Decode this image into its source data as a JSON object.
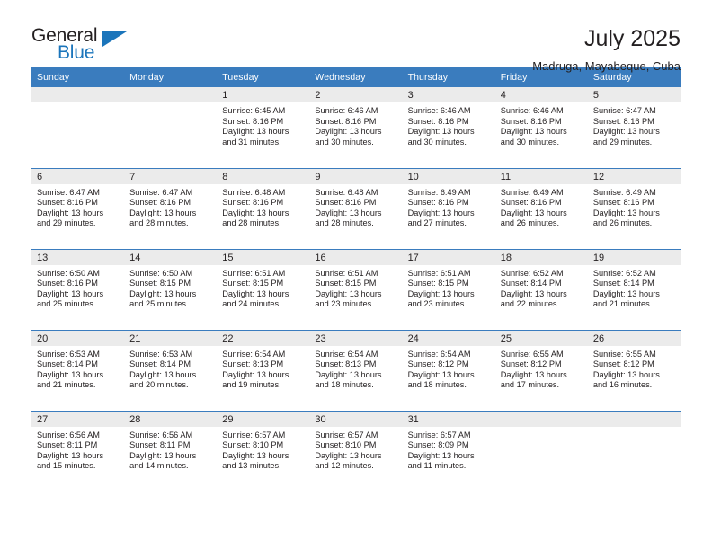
{
  "brand": {
    "name_part1": "General",
    "name_part2": "Blue",
    "triangle_icon": "triangle-icon",
    "accent_color": "#1b75bb"
  },
  "header": {
    "title": "July 2025",
    "location": "Madruga, Mayabeque, Cuba",
    "header_bg_color": "#3a7cbe",
    "daynum_bg_color": "#ebebeb"
  },
  "weekdays": [
    "Sunday",
    "Monday",
    "Tuesday",
    "Wednesday",
    "Thursday",
    "Friday",
    "Saturday"
  ],
  "weeks": [
    [
      {
        "day": "",
        "lines": []
      },
      {
        "day": "",
        "lines": []
      },
      {
        "day": "1",
        "lines": [
          "Sunrise: 6:45 AM",
          "Sunset: 8:16 PM",
          "Daylight: 13 hours",
          "and 31 minutes."
        ]
      },
      {
        "day": "2",
        "lines": [
          "Sunrise: 6:46 AM",
          "Sunset: 8:16 PM",
          "Daylight: 13 hours",
          "and 30 minutes."
        ]
      },
      {
        "day": "3",
        "lines": [
          "Sunrise: 6:46 AM",
          "Sunset: 8:16 PM",
          "Daylight: 13 hours",
          "and 30 minutes."
        ]
      },
      {
        "day": "4",
        "lines": [
          "Sunrise: 6:46 AM",
          "Sunset: 8:16 PM",
          "Daylight: 13 hours",
          "and 30 minutes."
        ]
      },
      {
        "day": "5",
        "lines": [
          "Sunrise: 6:47 AM",
          "Sunset: 8:16 PM",
          "Daylight: 13 hours",
          "and 29 minutes."
        ]
      }
    ],
    [
      {
        "day": "6",
        "lines": [
          "Sunrise: 6:47 AM",
          "Sunset: 8:16 PM",
          "Daylight: 13 hours",
          "and 29 minutes."
        ]
      },
      {
        "day": "7",
        "lines": [
          "Sunrise: 6:47 AM",
          "Sunset: 8:16 PM",
          "Daylight: 13 hours",
          "and 28 minutes."
        ]
      },
      {
        "day": "8",
        "lines": [
          "Sunrise: 6:48 AM",
          "Sunset: 8:16 PM",
          "Daylight: 13 hours",
          "and 28 minutes."
        ]
      },
      {
        "day": "9",
        "lines": [
          "Sunrise: 6:48 AM",
          "Sunset: 8:16 PM",
          "Daylight: 13 hours",
          "and 28 minutes."
        ]
      },
      {
        "day": "10",
        "lines": [
          "Sunrise: 6:49 AM",
          "Sunset: 8:16 PM",
          "Daylight: 13 hours",
          "and 27 minutes."
        ]
      },
      {
        "day": "11",
        "lines": [
          "Sunrise: 6:49 AM",
          "Sunset: 8:16 PM",
          "Daylight: 13 hours",
          "and 26 minutes."
        ]
      },
      {
        "day": "12",
        "lines": [
          "Sunrise: 6:49 AM",
          "Sunset: 8:16 PM",
          "Daylight: 13 hours",
          "and 26 minutes."
        ]
      }
    ],
    [
      {
        "day": "13",
        "lines": [
          "Sunrise: 6:50 AM",
          "Sunset: 8:16 PM",
          "Daylight: 13 hours",
          "and 25 minutes."
        ]
      },
      {
        "day": "14",
        "lines": [
          "Sunrise: 6:50 AM",
          "Sunset: 8:15 PM",
          "Daylight: 13 hours",
          "and 25 minutes."
        ]
      },
      {
        "day": "15",
        "lines": [
          "Sunrise: 6:51 AM",
          "Sunset: 8:15 PM",
          "Daylight: 13 hours",
          "and 24 minutes."
        ]
      },
      {
        "day": "16",
        "lines": [
          "Sunrise: 6:51 AM",
          "Sunset: 8:15 PM",
          "Daylight: 13 hours",
          "and 23 minutes."
        ]
      },
      {
        "day": "17",
        "lines": [
          "Sunrise: 6:51 AM",
          "Sunset: 8:15 PM",
          "Daylight: 13 hours",
          "and 23 minutes."
        ]
      },
      {
        "day": "18",
        "lines": [
          "Sunrise: 6:52 AM",
          "Sunset: 8:14 PM",
          "Daylight: 13 hours",
          "and 22 minutes."
        ]
      },
      {
        "day": "19",
        "lines": [
          "Sunrise: 6:52 AM",
          "Sunset: 8:14 PM",
          "Daylight: 13 hours",
          "and 21 minutes."
        ]
      }
    ],
    [
      {
        "day": "20",
        "lines": [
          "Sunrise: 6:53 AM",
          "Sunset: 8:14 PM",
          "Daylight: 13 hours",
          "and 21 minutes."
        ]
      },
      {
        "day": "21",
        "lines": [
          "Sunrise: 6:53 AM",
          "Sunset: 8:14 PM",
          "Daylight: 13 hours",
          "and 20 minutes."
        ]
      },
      {
        "day": "22",
        "lines": [
          "Sunrise: 6:54 AM",
          "Sunset: 8:13 PM",
          "Daylight: 13 hours",
          "and 19 minutes."
        ]
      },
      {
        "day": "23",
        "lines": [
          "Sunrise: 6:54 AM",
          "Sunset: 8:13 PM",
          "Daylight: 13 hours",
          "and 18 minutes."
        ]
      },
      {
        "day": "24",
        "lines": [
          "Sunrise: 6:54 AM",
          "Sunset: 8:12 PM",
          "Daylight: 13 hours",
          "and 18 minutes."
        ]
      },
      {
        "day": "25",
        "lines": [
          "Sunrise: 6:55 AM",
          "Sunset: 8:12 PM",
          "Daylight: 13 hours",
          "and 17 minutes."
        ]
      },
      {
        "day": "26",
        "lines": [
          "Sunrise: 6:55 AM",
          "Sunset: 8:12 PM",
          "Daylight: 13 hours",
          "and 16 minutes."
        ]
      }
    ],
    [
      {
        "day": "27",
        "lines": [
          "Sunrise: 6:56 AM",
          "Sunset: 8:11 PM",
          "Daylight: 13 hours",
          "and 15 minutes."
        ]
      },
      {
        "day": "28",
        "lines": [
          "Sunrise: 6:56 AM",
          "Sunset: 8:11 PM",
          "Daylight: 13 hours",
          "and 14 minutes."
        ]
      },
      {
        "day": "29",
        "lines": [
          "Sunrise: 6:57 AM",
          "Sunset: 8:10 PM",
          "Daylight: 13 hours",
          "and 13 minutes."
        ]
      },
      {
        "day": "30",
        "lines": [
          "Sunrise: 6:57 AM",
          "Sunset: 8:10 PM",
          "Daylight: 13 hours",
          "and 12 minutes."
        ]
      },
      {
        "day": "31",
        "lines": [
          "Sunrise: 6:57 AM",
          "Sunset: 8:09 PM",
          "Daylight: 13 hours",
          "and 11 minutes."
        ]
      },
      {
        "day": "",
        "lines": []
      },
      {
        "day": "",
        "lines": []
      }
    ]
  ]
}
